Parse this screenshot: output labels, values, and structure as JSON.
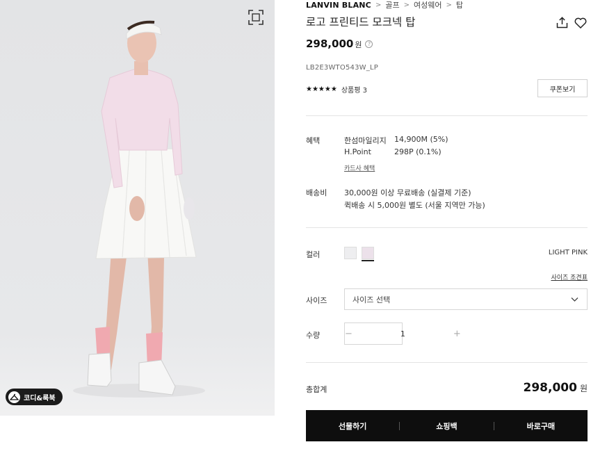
{
  "photo": {
    "zoom_icon": "expand-icon",
    "coordi_badge": {
      "icon": "hanger-icon",
      "label": "코디&룩북"
    }
  },
  "breadcrumb": {
    "brand": "LANVIN BLANC",
    "items": [
      "골프",
      "여성웨어",
      "탑"
    ],
    "separator": ">"
  },
  "product": {
    "title": "로고 프린티드 모크넥 탑",
    "price": "298,000",
    "price_unit": "원",
    "price_help": "?",
    "code": "LB2E3WTO543W_LP",
    "rating_stars": "★★★★★",
    "rating_value": 5,
    "review_label": "상품평 3",
    "coupon_label": "쿠폰보기",
    "share_icon": "share-icon",
    "wishlist_icon": "heart-icon"
  },
  "benefit": {
    "label": "혜택",
    "items": [
      {
        "name": "한섬마일리지",
        "value": "14,900M (5%)"
      },
      {
        "name": "H.Point",
        "value": "298P (0.1%)"
      }
    ],
    "card_link": "카드사 혜택"
  },
  "shipping": {
    "label": "배송비",
    "lines": [
      "30,000원 이상 무료배송 (실결제 기준)",
      "퀵배송 시 5,000원 별도 (서울 지역만 가능)"
    ]
  },
  "color": {
    "label": "컬러",
    "swatches": [
      {
        "name": "white",
        "hex": "#eeeef0",
        "selected": false
      },
      {
        "name": "light-pink",
        "hex": "#ece1ea",
        "selected": true
      }
    ],
    "selected_name": "LIGHT PINK",
    "size_guide": "사이즈 조견표"
  },
  "size": {
    "label": "사이즈",
    "placeholder": "사이즈 선택"
  },
  "quantity": {
    "label": "수량",
    "value": "1",
    "minus": "−",
    "plus": "+"
  },
  "total": {
    "label": "총합계",
    "price": "298,000",
    "unit": "원"
  },
  "actions": {
    "gift": "선물하기",
    "bag": "쇼핑백",
    "buy": "바로구매"
  },
  "colors": {
    "action_bar": "#0e0e0e",
    "photo_bg": "#e4e5e7"
  }
}
